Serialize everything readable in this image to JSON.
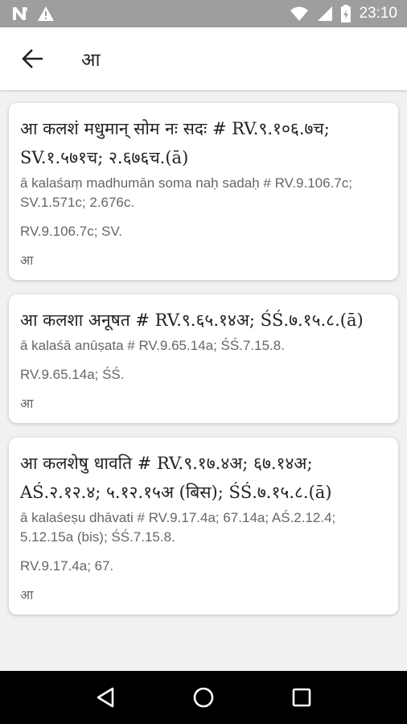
{
  "status_bar": {
    "time": "23:10",
    "icons": [
      "n-notification-icon",
      "warning-icon",
      "wifi-icon",
      "signal-icon",
      "battery-icon"
    ]
  },
  "app_bar": {
    "title": "आ",
    "back_icon": "arrow-left-icon"
  },
  "entries": [
    {
      "title": "आ कलशं मधुमान् सोम नः सदः # RV.९.१०६.७च; SV.१.५७१च; २.६७६च.(ā)",
      "translit": "ā kalaśaṃ madhumān soma naḥ sadaḥ # RV.9.106.7c; SV.1.571c; 2.676c.",
      "refs": "RV.9.106.7c; SV.",
      "word": "आ"
    },
    {
      "title": "आ कलशा अनूषत # RV.९.६५.१४अ; ŚŚ.७.१५.८.(ā)",
      "translit": "ā kalaśā anūṣata # RV.9.65.14a; ŚŚ.7.15.8.",
      "refs": "RV.9.65.14a; ŚŚ.",
      "word": "आ"
    },
    {
      "title": "आ कलशेषु धावति # RV.९.१७.४अ; ६७.१४अ; AŚ.२.१२.४; ५.१२.१५अ (बिस); ŚŚ.७.१५.८.(ā)",
      "translit": "ā kalaśeṣu dhāvati # RV.9.17.4a; 67.14a; AŚ.2.12.4; 5.12.15a (bis); ŚŚ.7.15.8.",
      "refs": "RV.9.17.4a; 67.",
      "word": "आ"
    }
  ],
  "nav_bar": {
    "icons": [
      "back-triangle-icon",
      "home-circle-icon",
      "recents-square-icon"
    ]
  },
  "colors": {
    "status_bar": "#9e9e9e",
    "background": "#f1f1f1",
    "card": "#ffffff",
    "secondary_text": "#666666"
  }
}
